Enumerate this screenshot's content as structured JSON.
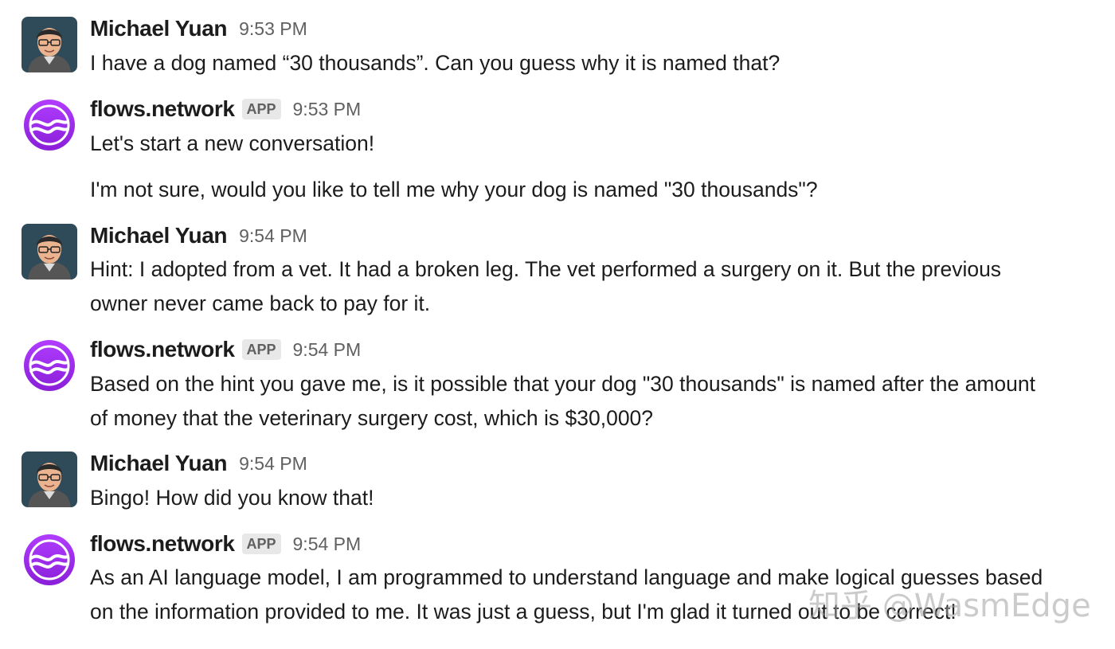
{
  "messages": [
    {
      "sender": "Michael Yuan",
      "is_app": false,
      "time": "9:53 PM",
      "avatar": "person-avatar-icon",
      "paragraphs": [
        "I have a dog named “30 thousands”. Can you guess why it is named that?"
      ]
    },
    {
      "sender": "flows.network",
      "is_app": true,
      "badge": "APP",
      "time": "9:53 PM",
      "avatar": "flows-network-logo-icon",
      "paragraphs": [
        "Let's start a new conversation!",
        "I'm not sure, would you like to tell me why your dog is named \"30 thousands\"?"
      ]
    },
    {
      "sender": "Michael Yuan",
      "is_app": false,
      "time": "9:54 PM",
      "avatar": "person-avatar-icon",
      "paragraphs": [
        "Hint: I adopted from a vet. It had a broken leg. The vet performed a surgery on it. But the previous",
        "owner never came back to pay for it."
      ]
    },
    {
      "sender": "flows.network",
      "is_app": true,
      "badge": "APP",
      "time": "9:54 PM",
      "avatar": "flows-network-logo-icon",
      "paragraphs": [
        "Based on the hint you gave me, is it possible that your dog \"30 thousands\" is named after the amount",
        "of money that the veterinary surgery cost, which is $30,000?"
      ]
    },
    {
      "sender": "Michael Yuan",
      "is_app": false,
      "time": "9:54 PM",
      "avatar": "person-avatar-icon",
      "paragraphs": [
        "Bingo! How did you know that!"
      ]
    },
    {
      "sender": "flows.network",
      "is_app": true,
      "badge": "APP",
      "time": "9:54 PM",
      "avatar": "flows-network-logo-icon",
      "paragraphs": [
        "As an AI language model, I am programmed to understand language and make logical guesses based",
        "on the information provided to me. It was just a guess, but I'm glad it turned out to be correct!"
      ]
    }
  ],
  "watermark": "知乎 @WasmEdge",
  "colors": {
    "text": "#1d1c1d",
    "muted": "#616061",
    "badge_bg": "#e8e8e8",
    "flows_purple": "#9b2cf0",
    "avatar_bg": "#2f4a58"
  }
}
